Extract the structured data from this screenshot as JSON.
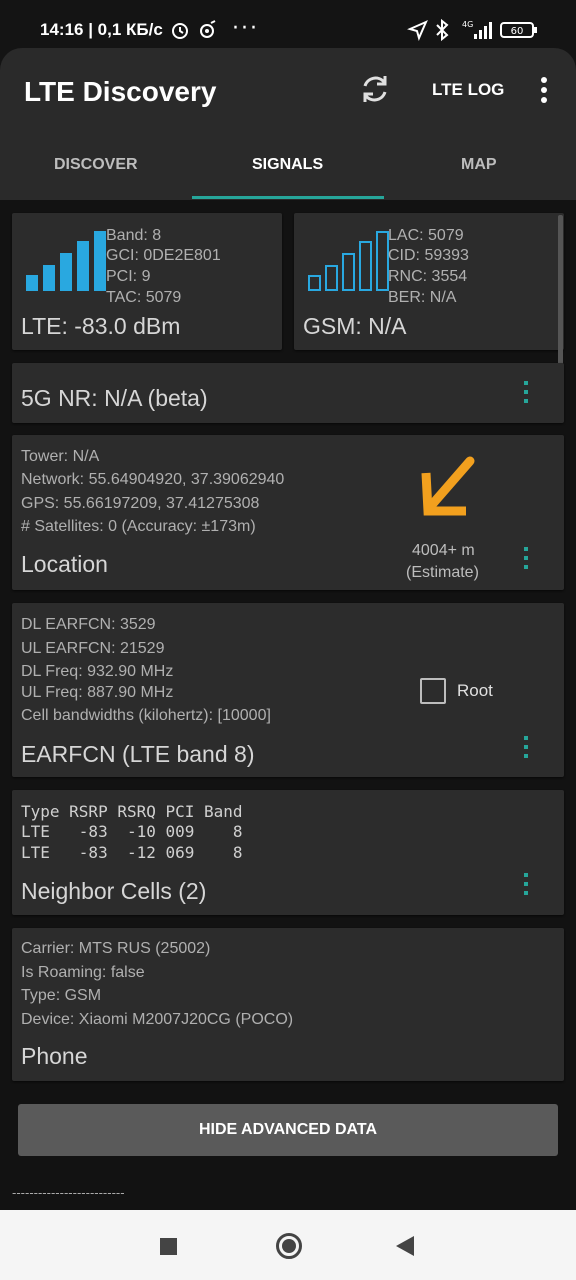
{
  "status_bar": {
    "time": "14:16 | 0,1 КБ/с",
    "battery": "60",
    "network": "4G"
  },
  "app_bar": {
    "title": "LTE Discovery",
    "lte_log_label": "LTE LOG"
  },
  "tabs": [
    {
      "label": "DISCOVER",
      "active": false
    },
    {
      "label": "SIGNALS",
      "active": true
    },
    {
      "label": "MAP",
      "active": false
    }
  ],
  "lte_card": {
    "band": "Band: 8",
    "gci": "GCI: 0DE2E801",
    "pci": "PCI: 9",
    "tac": "TAC: 5079",
    "signal": "LTE: -83.0 dBm",
    "bar_color": "#29a8e0",
    "bars_filled": 4
  },
  "gsm_card": {
    "lac": "LAC: 5079",
    "cid": "CID: 59393",
    "rnc": "RNC: 3554",
    "ber": "BER: N/A",
    "signal": "GSM: N/A",
    "bars_filled": 0
  },
  "nr_card": {
    "title": "5G NR: N/A (beta)"
  },
  "location_card": {
    "tower": "Tower: N/A",
    "network": "Network: 55.64904920, 37.39062940",
    "gps": "GPS: 55.66197209, 37.41275308",
    "satellites": "# Satellites: 0 (Accuracy: ±173m)",
    "title": "Location",
    "distance": "4004+ m",
    "estimate": "(Estimate)",
    "arrow_color": "#f2a01e"
  },
  "earfcn_card": {
    "dl_earfcn": "DL EARFCN: 3529",
    "ul_earfcn": "UL EARFCN: 21529",
    "dl_freq": "DL Freq: 932.90 MHz",
    "ul_freq": "UL Freq: 887.90 MHz",
    "bandwidths": "Cell bandwidths (kilohertz): [10000]",
    "title": "EARFCN (LTE band 8)",
    "root_label": "Root",
    "root_checked": false
  },
  "neighbor_card": {
    "header": "Type RSRP RSRQ PCI Band",
    "rows": [
      "LTE   -83  -10 009    8",
      "LTE   -83  -12 069    8"
    ],
    "title": "Neighbor Cells (2)"
  },
  "phone_card": {
    "carrier": "Carrier: MTS RUS (25002)",
    "roaming": "Is Roaming: false",
    "type": "Type: GSM",
    "device": "Device: Xiaomi M2007J20CG (POCO)",
    "title": "Phone"
  },
  "hide_button": "HIDE ADVANCED DATA",
  "footer_dashes": "--------------------------",
  "colors": {
    "accent": "#26a69a",
    "bars_lte": "#29a8e0",
    "arrow": "#f2a01e"
  }
}
